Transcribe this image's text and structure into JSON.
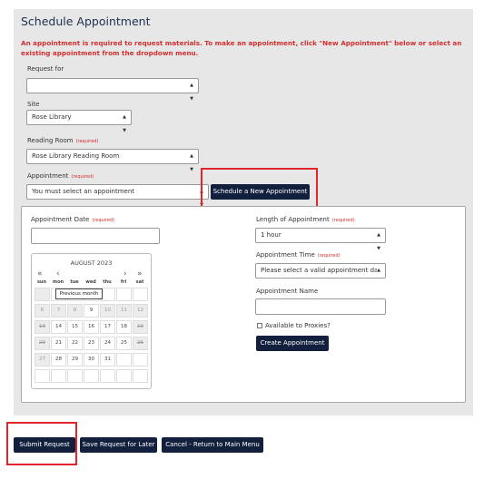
{
  "page": {
    "title": "Schedule Appointment"
  },
  "notice": "An appointment is required to request materials. To make an appointment, click \"New Appointment\" below or select an existing appointment from the dropdown menu.",
  "form": {
    "request_for": {
      "label": "Request for",
      "value": ""
    },
    "site": {
      "label": "Site",
      "value": "Rose Library"
    },
    "reading_room": {
      "label": "Reading Room",
      "required": "(required)",
      "value": "Rose Library Reading Room"
    },
    "appointment": {
      "label": "Appointment",
      "required": "(required)",
      "value": "You must select an appointment"
    },
    "schedule_button": "Schedule a New Appointment"
  },
  "panel": {
    "appointment_date": {
      "label": "Appointment Date",
      "required": "(required)",
      "value": ""
    },
    "length": {
      "label": "Length of Appointment",
      "required": "(required)",
      "value": "1 hour"
    },
    "time": {
      "label": "Appointment Time",
      "required": "(required)",
      "value": "Please select a valid appointment da"
    },
    "name": {
      "label": "Appointment Name",
      "value": ""
    },
    "proxies_label": "Available to Proxies?",
    "create_button": "Create Appointment"
  },
  "calendar": {
    "month": "AUGUST 2023",
    "nav": {
      "prev_year": "«",
      "prev": "‹",
      "next": "›",
      "next_year": "»"
    },
    "days": [
      "sun",
      "mon",
      "tue",
      "wed",
      "thu",
      "fri",
      "sat"
    ],
    "tooltip": "Previous month",
    "rows": [
      [
        {
          "t": "",
          "d": true
        },
        {
          "t": "",
          "d": false
        },
        {
          "t": "",
          "d": false
        },
        {
          "t": "",
          "d": false
        },
        {
          "t": "",
          "d": false
        },
        {
          "t": "",
          "d": false
        },
        {
          "t": "",
          "d": false
        }
      ],
      [
        {
          "t": "6",
          "d": true
        },
        {
          "t": "7",
          "d": true
        },
        {
          "t": "8",
          "d": true
        },
        {
          "t": "9",
          "d": false
        },
        {
          "t": "10",
          "d": true
        },
        {
          "t": "11",
          "d": true
        },
        {
          "t": "12",
          "d": true
        }
      ],
      [
        {
          "t": "13",
          "d": true,
          "s": true
        },
        {
          "t": "14",
          "d": false
        },
        {
          "t": "15",
          "d": false
        },
        {
          "t": "16",
          "d": false
        },
        {
          "t": "17",
          "d": false
        },
        {
          "t": "18",
          "d": false
        },
        {
          "t": "19",
          "d": true,
          "s": true
        }
      ],
      [
        {
          "t": "20",
          "d": true,
          "s": true
        },
        {
          "t": "21",
          "d": false
        },
        {
          "t": "22",
          "d": false
        },
        {
          "t": "23",
          "d": false
        },
        {
          "t": "24",
          "d": false
        },
        {
          "t": "25",
          "d": false
        },
        {
          "t": "26",
          "d": true,
          "s": true
        }
      ],
      [
        {
          "t": "27",
          "d": true
        },
        {
          "t": "28",
          "d": false
        },
        {
          "t": "29",
          "d": false
        },
        {
          "t": "30",
          "d": false
        },
        {
          "t": "31",
          "d": false
        },
        {
          "t": "",
          "d": false
        },
        {
          "t": "",
          "d": false
        }
      ],
      [
        {
          "t": "",
          "d": false
        },
        {
          "t": "",
          "d": false
        },
        {
          "t": "",
          "d": false
        },
        {
          "t": "",
          "d": false
        },
        {
          "t": "",
          "d": false
        },
        {
          "t": "",
          "d": false
        },
        {
          "t": "",
          "d": false
        }
      ]
    ]
  },
  "bottom": {
    "submit": "Submit Request",
    "save": "Save Request for Later",
    "cancel": "Cancel - Return to Main Menu"
  }
}
